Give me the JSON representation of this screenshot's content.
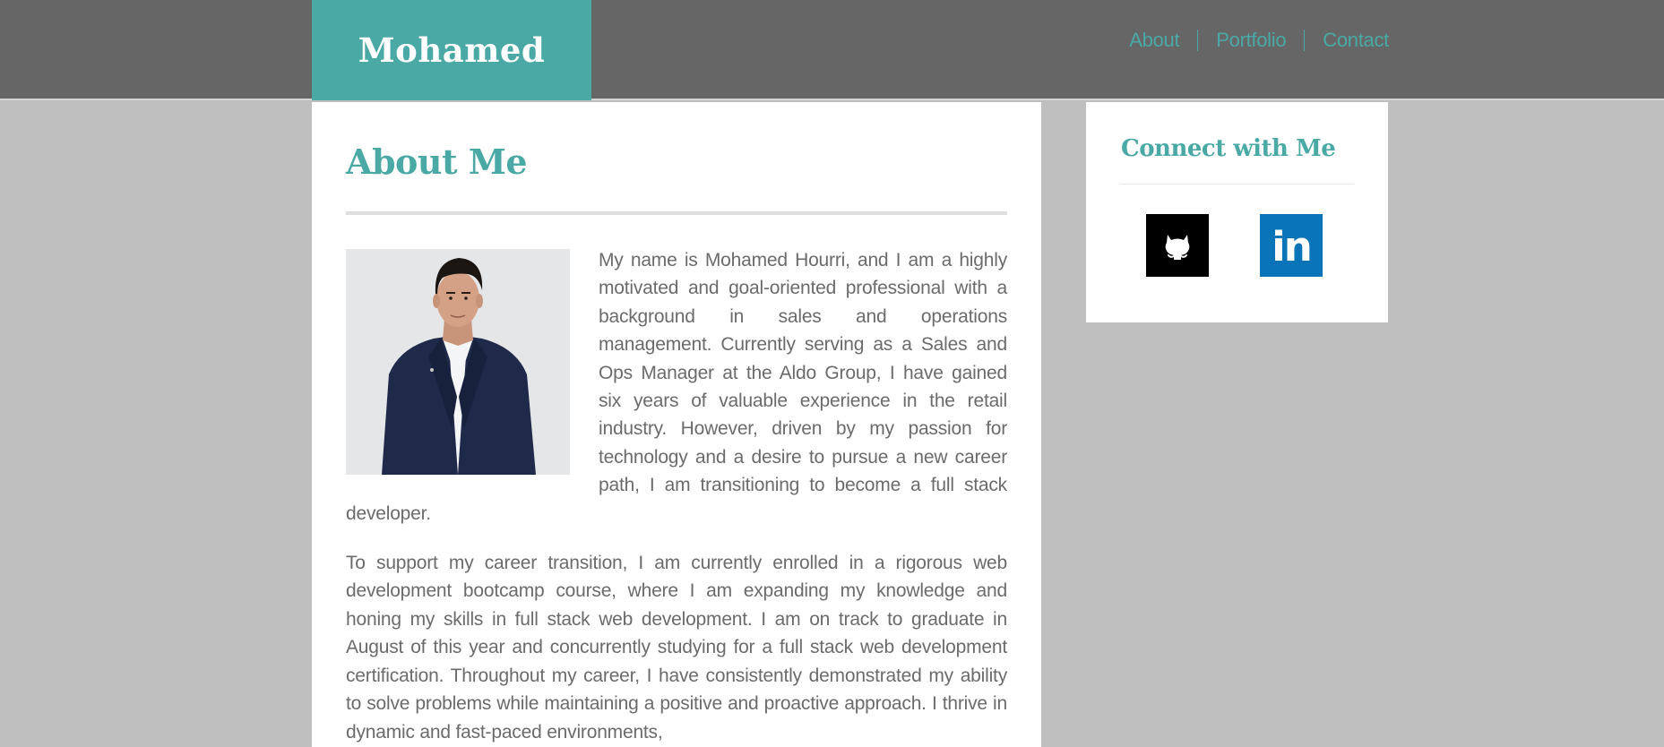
{
  "header": {
    "logo": "Mohamed",
    "nav": [
      {
        "label": "About"
      },
      {
        "label": "Portfolio"
      },
      {
        "label": "Contact"
      }
    ]
  },
  "about": {
    "title": "About Me",
    "paragraphs": [
      "My name is Mohamed Hourri, and I am a highly motivated and goal-oriented professional with a background in sales and operations management. Currently serving as a Sales and Ops Manager at the Aldo Group, I have gained six years of valuable experience in the retail industry. However, driven by my passion for technology and a desire to pursue a new career path, I am transitioning to become a full stack developer.",
      "To support my career transition, I am currently enrolled in a rigorous web development bootcamp course, where I am expanding my knowledge and honing my skills in full stack web development. I am on track to graduate in August of this year and concurrently studying for a full stack web development certification. Throughout my career, I have consistently demonstrated my ability to solve problems while maintaining a positive and proactive approach. I thrive in dynamic and fast-paced environments,"
    ]
  },
  "sidebar": {
    "title": "Connect with Me",
    "social": [
      {
        "icon": "github-icon"
      },
      {
        "icon": "linkedin-icon",
        "label": "in"
      }
    ]
  },
  "colors": {
    "accent": "#4aa9a5",
    "header_bg": "#666666",
    "page_bg": "#bfbfbf",
    "text": "#6b6b6b",
    "github": "#000000",
    "linkedin": "#0a74b8"
  }
}
